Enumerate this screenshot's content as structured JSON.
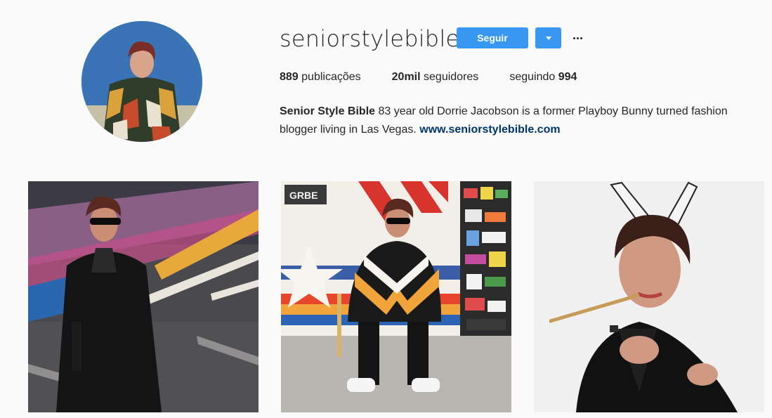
{
  "profile": {
    "username": "seniorstylebible",
    "follow_label": "Seguir",
    "more_label": "..."
  },
  "stats": {
    "posts_count": "889",
    "posts_label": "publicações",
    "followers_count": "20mil",
    "followers_label": "seguidores",
    "following_label": "seguindo",
    "following_count": "994"
  },
  "bio": {
    "name": "Senior Style Bible",
    "text": "83 year old Dorrie Jacobson is a former Playboy Bunny turned fashion blogger living in Las Vegas.",
    "link": "www.seniorstylebible.com"
  },
  "posts": {
    "post2_sign": "GRBE"
  },
  "colors": {
    "accent": "#3897f0",
    "link": "#003569",
    "background": "#fafafa",
    "text": "#262626"
  },
  "icons": {
    "dropdown": "caret-down-icon",
    "more": "ellipsis-icon"
  }
}
